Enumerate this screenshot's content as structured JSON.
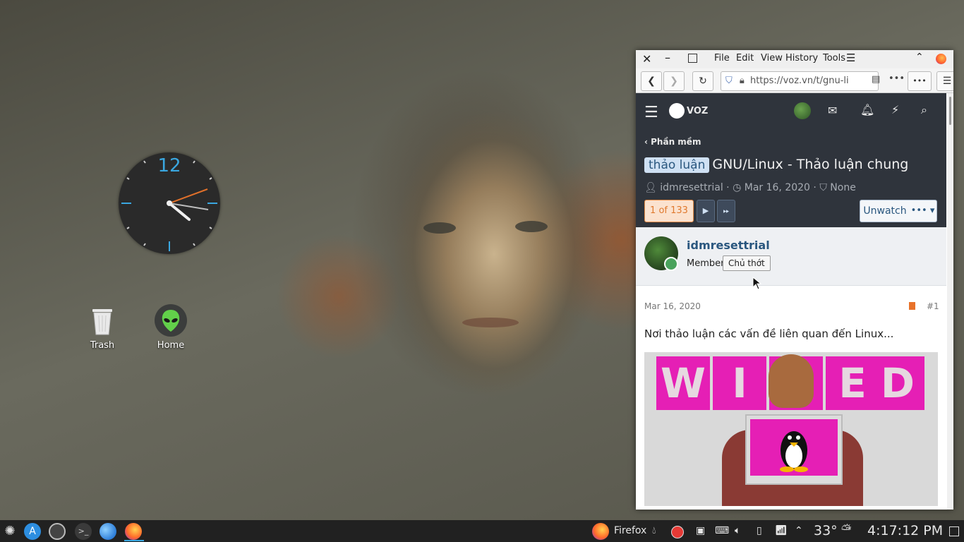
{
  "desktop": {
    "clock": {
      "twelve_label": "12",
      "hour": 4,
      "minute": 17
    },
    "icons": [
      {
        "label": "Trash",
        "icon": "trash-icon"
      },
      {
        "label": "Home",
        "icon": "alien-home-icon"
      }
    ]
  },
  "browser": {
    "menu": [
      "File",
      "Edit",
      "View",
      "History",
      "Tools"
    ],
    "url": "https://voz.vn/t/gnu-li",
    "site": {
      "logo_text": "VOZ",
      "breadcrumb": "Phần mềm",
      "thread_prefix": "thảo luận",
      "thread_title": "GNU/Linux - Thảo luận chung",
      "author": "idmresettrial",
      "date": "Mar 16, 2020",
      "tags": "None",
      "pager_current": "1 of 133",
      "unwatch_label": "Unwatch",
      "more_label": "•••"
    },
    "post": {
      "username": "idmresettrial",
      "role": "Member",
      "badge": "Chủ thớt",
      "date": "Mar 16, 2020",
      "number": "#1",
      "text": "Nơi thảo luận các vấn đề liên quan đến Linux...",
      "image_letters": [
        "W",
        "I",
        "",
        "E",
        "D"
      ]
    }
  },
  "taskbar": {
    "active_app_label": "Firefox",
    "temperature": "33°",
    "time": "4:17:12 PM"
  },
  "colors": {
    "accent_blue": "#3aa7e0",
    "site_header": "#2f343c",
    "pager_orange": "#e0792e",
    "wired_magenta": "#e51fb5"
  }
}
